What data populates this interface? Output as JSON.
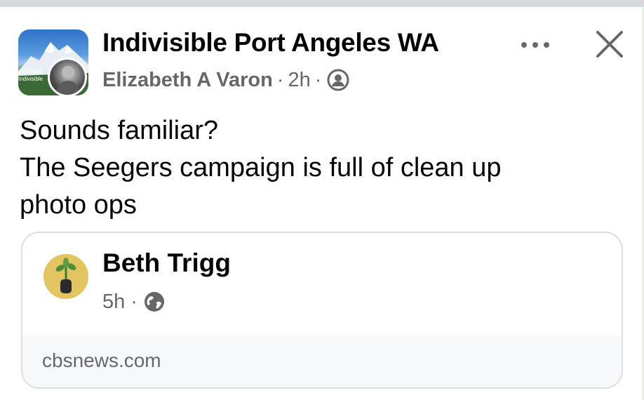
{
  "post": {
    "group_name": "Indivisible Port Angeles WA",
    "author": "Elizabeth A Varon",
    "time": "2h",
    "separator": "·",
    "audience_icon": "members-icon",
    "group_avatar_banner": [
      "Indivisible",
      "Indivisible"
    ],
    "text_lines": [
      "Sounds familiar?",
      "The Seegers campaign is full of clean up",
      "photo ops"
    ]
  },
  "actions": {
    "more_icon": "more-horizontal-icon",
    "close_icon": "close-icon"
  },
  "shared": {
    "name": "Beth Trigg",
    "time": "5h",
    "separator": "·",
    "audience_icon": "globe-icon",
    "link_domain": "cbsnews.com"
  },
  "colors": {
    "primary_text": "#050505",
    "secondary_text": "#65676b",
    "card_border": "#dadde1",
    "link_bar_bg": "#f7f8fa"
  }
}
